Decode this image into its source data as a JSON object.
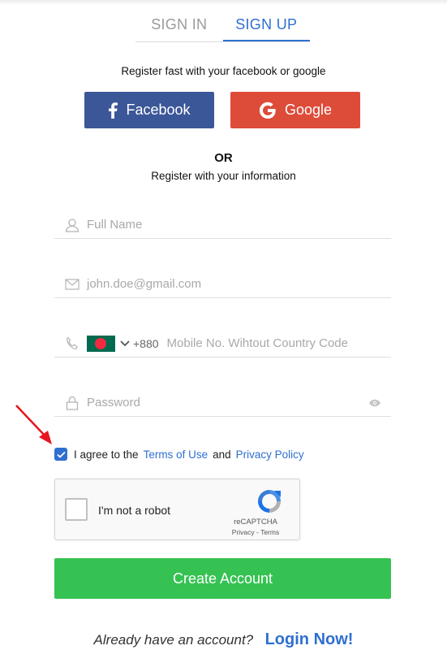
{
  "tabs": [
    {
      "label": "SIGN IN",
      "active": false
    },
    {
      "label": "SIGN UP",
      "active": true
    }
  ],
  "social": {
    "intro": "Register fast with your facebook or google",
    "facebook_label": "Facebook",
    "google_label": "Google"
  },
  "divider": {
    "or": "OR",
    "info": "Register with your information"
  },
  "form": {
    "full_name": {
      "placeholder": "Full Name",
      "value": ""
    },
    "email": {
      "placeholder": "john.doe@gmail.com",
      "value": ""
    },
    "phone": {
      "country_code": "+880",
      "placeholder": "Mobile No. Wihtout Country Code",
      "value": "",
      "flag": "bangladesh-flag"
    },
    "password": {
      "placeholder": "Password",
      "value": ""
    }
  },
  "agreement": {
    "checked": true,
    "prefix": "I agree to the",
    "terms_link": "Terms of Use",
    "and": "and",
    "privacy_link": "Privacy Policy"
  },
  "captcha": {
    "label": "I'm not a robot",
    "brand": "reCAPTCHA",
    "links": "Privacy - Terms"
  },
  "create_button": "Create Account",
  "footer": {
    "question": "Already have an account?",
    "login_link": "Login Now!"
  },
  "colors": {
    "accent": "#2f6fd1",
    "facebook": "#3b5798",
    "google": "#dd4b39",
    "create": "#35c252",
    "annotation_arrow": "#e8141e"
  }
}
